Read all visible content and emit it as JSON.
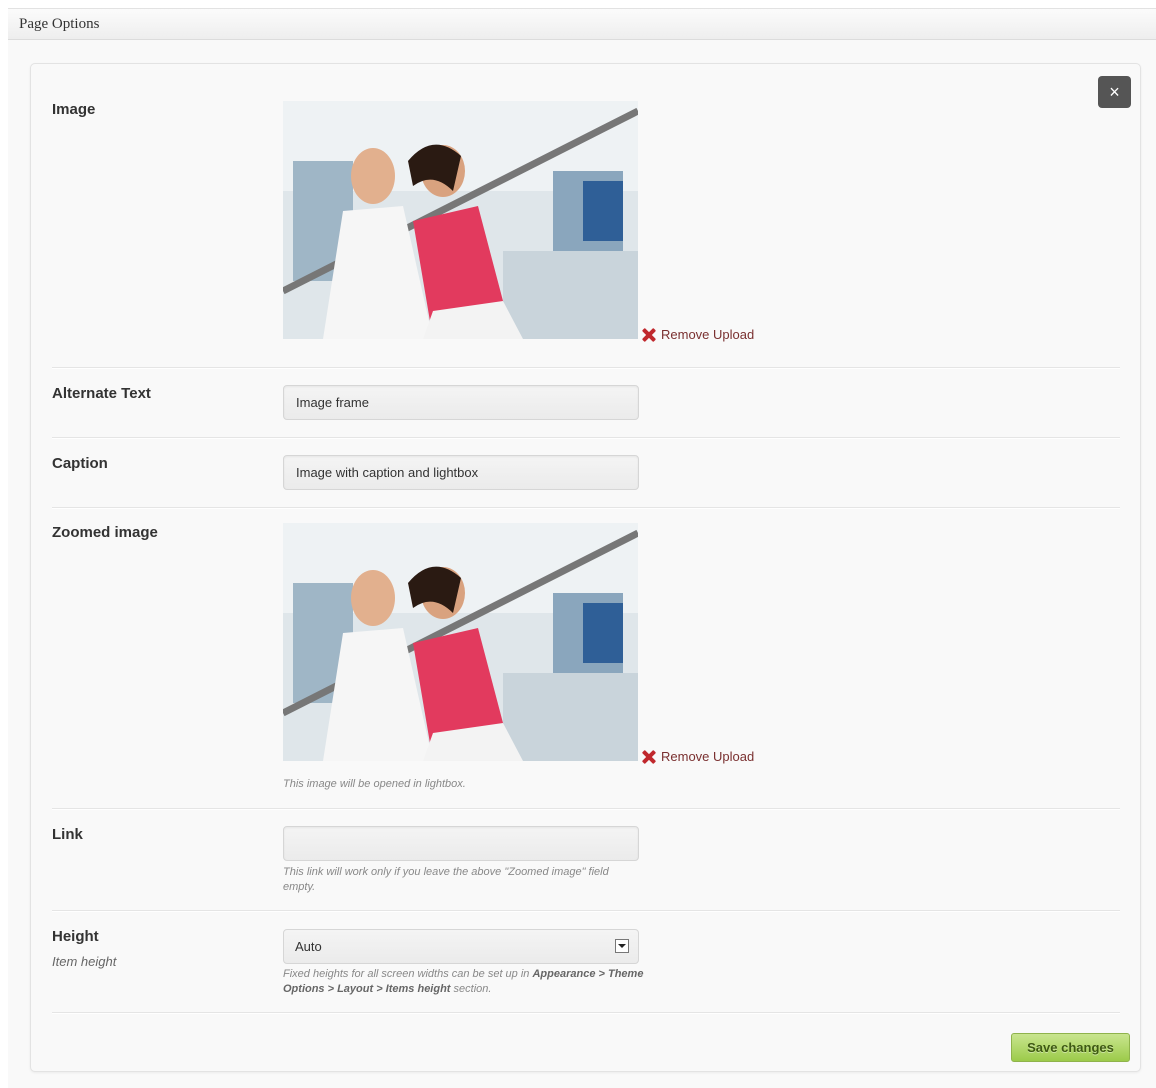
{
  "header": {
    "title": "Page Options"
  },
  "icons": {
    "close": "close-icon",
    "remove": "remove-icon",
    "dropdown": "chevron-down-icon"
  },
  "colors": {
    "save_button": "#9ccb4a",
    "remove_x": "#c0282d",
    "close_button": "#555555"
  },
  "close_symbol": "×",
  "fields": {
    "image": {
      "label": "Image",
      "remove_label": "Remove Upload"
    },
    "alt_text": {
      "label": "Alternate Text",
      "value": "Image frame"
    },
    "caption": {
      "label": "Caption",
      "value": "Image with caption and lightbox"
    },
    "zoomed_image": {
      "label": "Zoomed image",
      "remove_label": "Remove Upload",
      "help": "This image will be opened in lightbox."
    },
    "link": {
      "label": "Link",
      "value": "",
      "help": "This link will work only if you leave the above \"Zoomed image\" field empty."
    },
    "height": {
      "label": "Height",
      "sublabel": "Item height",
      "selected": "Auto",
      "help_prefix": "Fixed heights for all screen widths can be set up in ",
      "help_bold": "Appearance > Theme Options > Layout > Items height",
      "help_suffix": " section."
    }
  },
  "save_label": "Save changes"
}
